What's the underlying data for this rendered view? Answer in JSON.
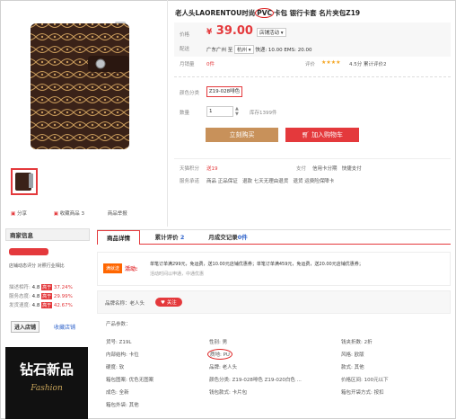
{
  "product": {
    "title_prefix": "老人头LAORENTOU时尚",
    "title_highlight": "PVC",
    "title_suffix": "卡包 银行卡套 名片夹包Z19",
    "price_label": "价格",
    "currency": "¥",
    "price": "39.00",
    "promo_dropdown": "店铺活动",
    "shipping_label": "配送",
    "shipping_from": "广东广州",
    "shipping_to_word": "至",
    "shipping_dest": "杭州",
    "shipping_text": "快递: 10.00 EMS: 20.00",
    "sold_label": "月销量",
    "sold_value": "0件",
    "rating_label": "评价",
    "stars": "★★★★",
    "rating_text": "4.5分 累计评价2",
    "color_label": "颜色分类",
    "color_value": "Z19-028啡色",
    "qty_label": "数量",
    "qty_value": "1",
    "stock_text": "库存1399件",
    "buy_label": "立刻购买",
    "cart_label": "加入购物车",
    "points_label": "天猫积分",
    "points_value": "送19",
    "pay_label": "支付",
    "pay_methods": "信用卡分期   快捷支付",
    "service_label": "服务承诺",
    "service_items": "商品 正品保证   退款 七天无理由退货   退货 运费险保障卡"
  },
  "gallery": {
    "share_label": "分享",
    "fav_label": "收藏商品",
    "fav_count": "3",
    "report_label": "商品举报"
  },
  "seller": {
    "title": "商家信息",
    "dsr_title": "店铺动态评分  对照行业相比",
    "rows": [
      {
        "label": "描述相符:",
        "score": "4.8",
        "badge": "高于",
        "pct": "37.24%"
      },
      {
        "label": "服务态度:",
        "score": "4.8",
        "badge": "高于",
        "pct": "29.99%"
      },
      {
        "label": "发货速度:",
        "score": "4.8",
        "badge": "高于",
        "pct": "42.67%"
      }
    ],
    "enter_label": "进入店铺",
    "collect_label": "收藏店铺"
  },
  "banner": {
    "text": "钻石新品",
    "script": "Fashion"
  },
  "tabs": [
    {
      "label": "商品详情"
    },
    {
      "label": "累计评价",
      "count": "2"
    },
    {
      "label": "月成交记录",
      "count": "0件"
    }
  ],
  "promo": {
    "badge": "满就送",
    "label": "活动:",
    "line1": "单笔订单满299元，免运费，送10.00元店铺优惠券；单笔订单满459元，免运费，送20.00元店铺优惠券；",
    "line2": "活动时间以申通，中通优惠"
  },
  "brand_row": {
    "label": "品牌名称：老人头",
    "follow": "关注"
  },
  "params_title": "产品参数：",
  "attrs": [
    [
      "货号: Z19L",
      "性别: 男",
      "钱夹折数: 2折"
    ],
    [
      "内部结构: 卡位",
      "质地: PU",
      "风格: 欧版"
    ],
    [
      "硬度: 软",
      "品牌: 老人头",
      "款式: 其他"
    ],
    [
      "箱包图案: 优色无图案",
      "颜色分类: Z19-028啡色 Z19-020白色 ...",
      "价格区间: 100元以下"
    ],
    [
      "成色: 全新",
      "钱包款式: 卡片包",
      "箱包开袋方式: 按扣"
    ],
    [
      "箱包外袋: 其他",
      "",
      ""
    ]
  ]
}
